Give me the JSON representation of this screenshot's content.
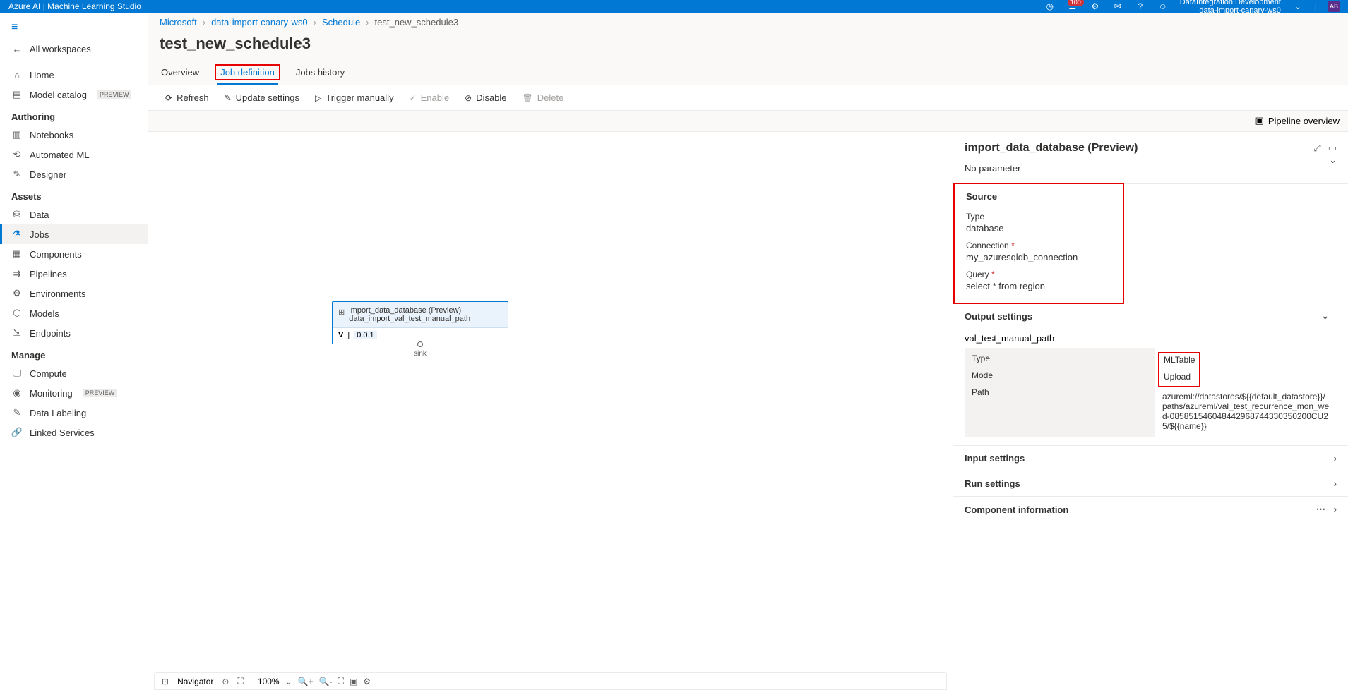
{
  "topbar": {
    "title": "Azure AI | Machine Learning Studio",
    "notification_count": "100",
    "workspace_line1": "DataIntegration Development",
    "workspace_line2": "data-import-canary-ws0",
    "avatar": "AB"
  },
  "sidebar": {
    "all_workspaces": "All workspaces",
    "home": "Home",
    "model_catalog": "Model catalog",
    "preview": "PREVIEW",
    "sections": {
      "authoring": "Authoring",
      "assets": "Assets",
      "manage": "Manage"
    },
    "items": {
      "notebooks": "Notebooks",
      "automated_ml": "Automated ML",
      "designer": "Designer",
      "data": "Data",
      "jobs": "Jobs",
      "components": "Components",
      "pipelines": "Pipelines",
      "environments": "Environments",
      "models": "Models",
      "endpoints": "Endpoints",
      "compute": "Compute",
      "monitoring": "Monitoring",
      "data_labeling": "Data Labeling",
      "linked_services": "Linked Services"
    }
  },
  "breadcrumb": {
    "b1": "Microsoft",
    "b2": "data-import-canary-ws0",
    "b3": "Schedule",
    "b4": "test_new_schedule3"
  },
  "page": {
    "title": "test_new_schedule3"
  },
  "tabs": {
    "overview": "Overview",
    "job_definition": "Job definition",
    "jobs_history": "Jobs history"
  },
  "toolbar": {
    "refresh": "Refresh",
    "update_settings": "Update settings",
    "trigger_manually": "Trigger manually",
    "enable": "Enable",
    "disable": "Disable",
    "delete": "Delete"
  },
  "pipeline_overview": "Pipeline overview",
  "node": {
    "title": "import_data_database (Preview)",
    "subtitle": "data_import_val_test_manual_path",
    "version_label": "V",
    "version": "0.0.1",
    "port": "sink"
  },
  "canvas_footer": {
    "navigator": "Navigator",
    "zoom": "100%"
  },
  "right_panel": {
    "title": "import_data_database (Preview)",
    "no_param": "No parameter",
    "sections": {
      "source": "Source",
      "output_settings": "Output settings",
      "input_settings": "Input settings",
      "run_settings": "Run settings",
      "component_info": "Component information"
    },
    "source": {
      "type_label": "Type",
      "type_value": "database",
      "connection_label": "Connection",
      "connection_value": "my_azuresqldb_connection",
      "query_label": "Query",
      "query_value": "select * from region"
    },
    "output": {
      "name": "val_test_manual_path",
      "type_label": "Type",
      "type_value": "MLTable",
      "mode_label": "Mode",
      "mode_value": "Upload",
      "path_label": "Path",
      "path_value": "azureml://datastores/${{default_datastore}}/paths/azureml/val_test_recurrence_mon_wed-085851546048442968744330350200CU25/${{name}}"
    }
  }
}
